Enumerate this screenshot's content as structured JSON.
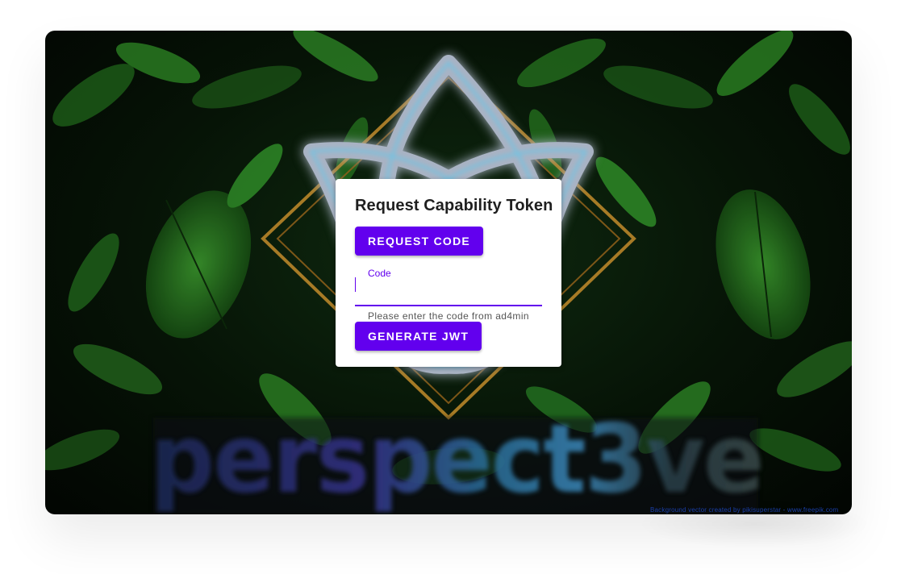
{
  "hero": {
    "wordmark": "perspect3ve",
    "logo_icon": "celtic-knot-star-icon"
  },
  "card": {
    "title": "Request Capability Token",
    "request_button_label": "REQUEST CODE",
    "code_field": {
      "label": "Code",
      "value": "",
      "helper": "Please enter the code from ad4min"
    },
    "generate_button_label": "GENERATE JWT"
  },
  "footer": {
    "credit": "Background vector created by pikisuperstar - www.freepik.com"
  },
  "colors": {
    "primary": "#6200ee",
    "background_dark": "#061306",
    "leaf_green": "#1e6b1a",
    "frame_gold": "#b8862a",
    "logo_glow": "#3fd2ff"
  }
}
